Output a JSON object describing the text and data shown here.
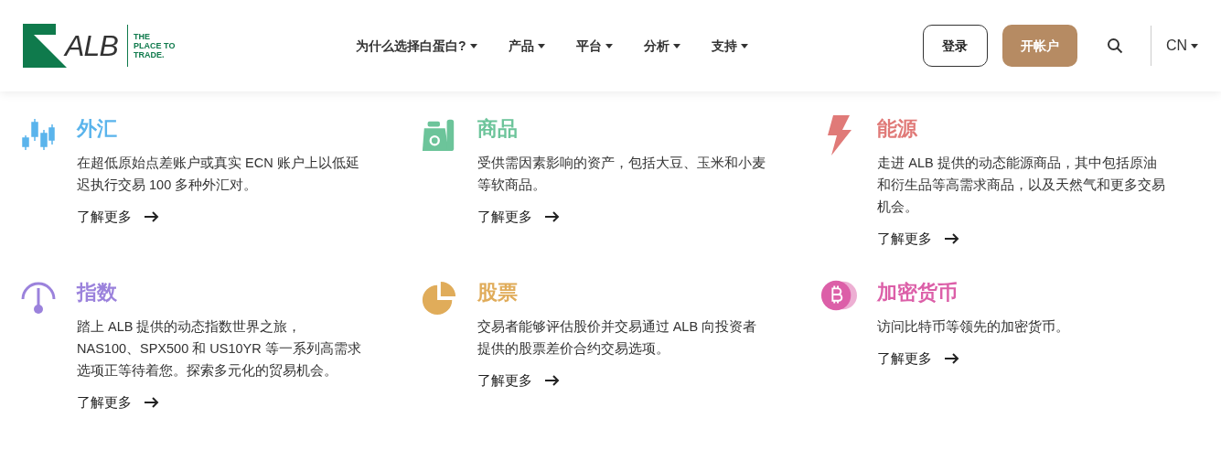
{
  "header": {
    "logo": {
      "wordmark": "ALB",
      "tagline": [
        "THE",
        "PLACE TO",
        "TRADE."
      ]
    },
    "nav": [
      {
        "label": "为什么选择白蛋白?"
      },
      {
        "label": "产品"
      },
      {
        "label": "平台"
      },
      {
        "label": "分析"
      },
      {
        "label": "支持"
      }
    ],
    "login_button": "登录",
    "open_account_button": "开帐户",
    "language": "CN"
  },
  "cards": [
    {
      "kind": "forex",
      "title": "外汇",
      "color": "#5ab4ec",
      "lines": [
        "在超低原始点差账户或真实 ECN 账户上以低延",
        "迟执行交易 100 多种外汇对。"
      ],
      "link": "了解更多"
    },
    {
      "kind": "commodities",
      "title": "商品",
      "color": "#6cc49a",
      "lines": [
        "受供需因素影响的资产，包括大豆、玉米和小麦",
        "等软商品。"
      ],
      "link": "了解更多"
    },
    {
      "kind": "energy",
      "title": "能源",
      "color": "#e07a78",
      "lines": [
        "走进 ALB 提供的动态能源商品，其中包括原油",
        "和衍生品等高需求商品，以及天然气和更多交易",
        "机会。"
      ],
      "link": "了解更多"
    },
    {
      "kind": "index",
      "title": "指数",
      "color": "#9b82dc",
      "lines": [
        "踏上 ALB 提供的动态指数世界之旅，",
        "NAS100、SPX500 和 US10YR 等一系列高需求",
        "选项正等待着您。探索多元化的贸易机会。"
      ],
      "link": "了解更多"
    },
    {
      "kind": "stocks",
      "title": "股票",
      "color": "#e0ac5a",
      "lines": [
        "交易者能够评估股价并交易通过 ALB 向投资者",
        "提供的股票差价合约交易选项。"
      ],
      "link": "了解更多"
    },
    {
      "kind": "crypto",
      "title": "加密货币",
      "color": "#dc5fa8",
      "lines": [
        "访问比特币等领先的加密货币。"
      ],
      "link": "了解更多"
    }
  ]
}
